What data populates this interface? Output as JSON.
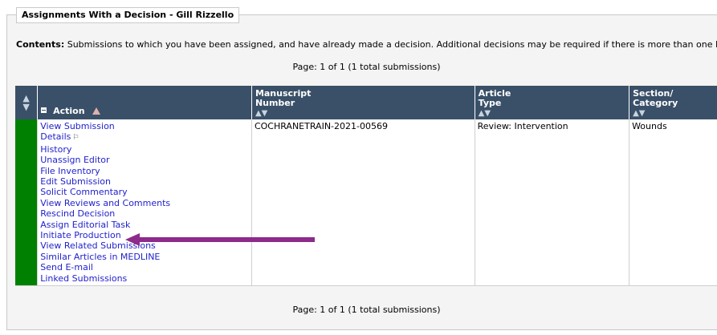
{
  "panel": {
    "title": "Assignments With a Decision - Gill Rizzello"
  },
  "contents": {
    "label": "Contents:",
    "text": "Submissions to which you have been assigned, and have already made a decision. Additional decisions may be required if there is more than one Ec"
  },
  "pager": {
    "top": "Page: 1 of 1 (1 total submissions)",
    "bottom": "Page: 1 of 1 (1 total submissions)"
  },
  "table": {
    "headers": {
      "action": "Action",
      "manuscript": [
        "Manuscript",
        "Number"
      ],
      "article": [
        "Article",
        "Type"
      ],
      "section": [
        "Section/",
        "Category"
      ]
    },
    "row": {
      "actions": [
        "View Submission",
        "Details",
        "History",
        "Unassign Editor",
        "File Inventory",
        "Edit Submission",
        "Solicit Commentary",
        "View Reviews and Comments",
        "Rescind Decision",
        "Assign Editorial Task",
        "Initiate Production",
        "View Related Submissions",
        "Similar Articles in MEDLINE",
        "Send E-mail",
        "Linked Submissions"
      ],
      "manuscript_number": "COCHRANETRAIN-2021-00569",
      "article_type": "Review: Intervention",
      "section": "Wounds",
      "status_color": "#008000"
    }
  },
  "annotation": {
    "arrow_color": "#8e2a8a",
    "target": "Initiate Production"
  },
  "colors": {
    "header_bg": "#3a5068",
    "link": "#2222cc"
  }
}
